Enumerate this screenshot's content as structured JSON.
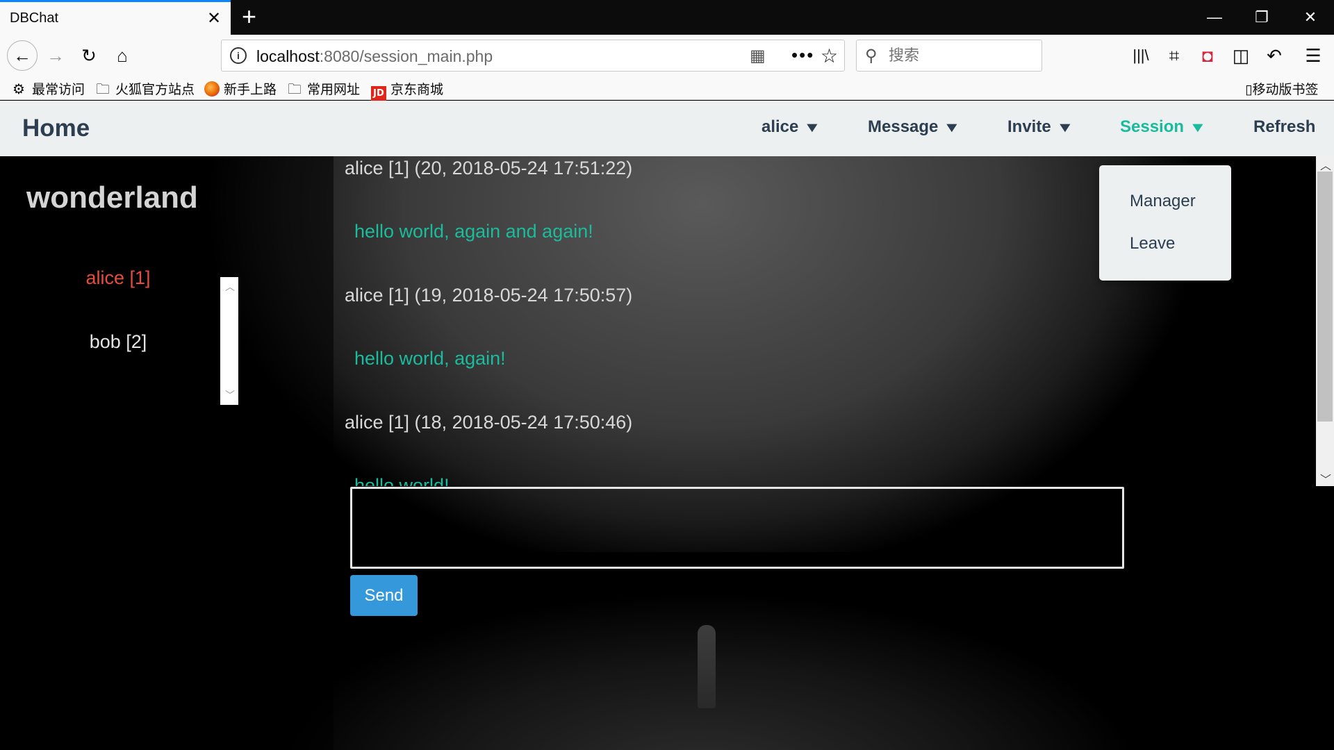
{
  "browser": {
    "tab_title": "DBChat",
    "tab_close": "✕",
    "new_tab": "+",
    "window_controls": {
      "minimize": "—",
      "restore": "❐",
      "close": "✕"
    },
    "url_host": "localhost",
    "url_path": ":8080/session_main.php",
    "search_placeholder": "搜索",
    "bookmarks": [
      "最常访问",
      "火狐官方站点",
      "新手上路",
      "常用网址",
      "京东商城"
    ],
    "bookmarks_right": "移动版书签",
    "jd_logo_text": "JD"
  },
  "nav": {
    "home": "Home",
    "items": [
      {
        "label": "alice",
        "caret": "▼"
      },
      {
        "label": "Message",
        "caret": "▼"
      },
      {
        "label": "Invite",
        "caret": "▼"
      },
      {
        "label": "Session",
        "caret": "▼",
        "active": true
      },
      {
        "label": "Refresh"
      }
    ],
    "active_color": "#18bc9c"
  },
  "session_menu": [
    "Manager",
    "Leave"
  ],
  "room": {
    "title": "wonderland",
    "users": [
      "alice [1]",
      "bob [2]"
    ]
  },
  "messages": [
    {
      "header": "alice [1] (20, 2018-05-24 17:51:22)",
      "body": "hello world, again and again!"
    },
    {
      "header": "alice [1] (19, 2018-05-24 17:50:57)",
      "body": "hello world, again!"
    },
    {
      "header": "alice [1] (18, 2018-05-24 17:50:46)",
      "body": "hello world!"
    }
  ],
  "composer": {
    "value": "",
    "send_label": "Send"
  },
  "icons": {
    "back": "←",
    "forward": "→",
    "reload": "↻",
    "home": "⌂",
    "more": "•••",
    "star": "☆",
    "search": "🔍",
    "library": "|||\\",
    "screenshot": "⌗",
    "pocket": "◘",
    "sidebar": "◫",
    "undo": "↶",
    "menu": "☰",
    "gear": "⚙",
    "folder": "🗀",
    "mobile": "▯"
  },
  "colors": {
    "accent": "#18bc9c",
    "message_text": "#1abc9c",
    "current_user": "#e74c3c",
    "send_button": "#3498db",
    "tab_accent": "#0a84ff"
  }
}
